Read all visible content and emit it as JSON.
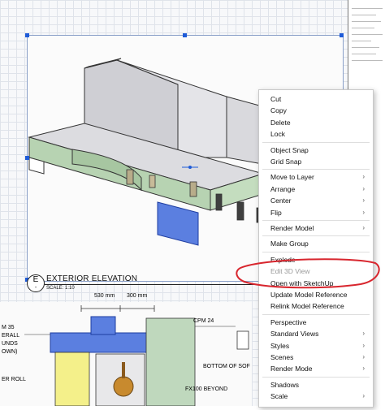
{
  "drawing": {
    "view_number": "E",
    "view_sub": "-",
    "view_title": "EXTERIOR ELEVATION",
    "scale": "SCALE: 1:10",
    "dim_left": "530 mm",
    "dim_right": "300 mm",
    "callouts": [
      "CPM 24",
      "BOTTOM OF SOF",
      "FX100 BEYOND"
    ],
    "left_notes": [
      "M 35",
      "ERALL",
      "UNDS",
      "OWN)",
      "ER ROLL"
    ]
  },
  "context_menu": {
    "groups": [
      [
        {
          "label": "Cut"
        },
        {
          "label": "Copy"
        },
        {
          "label": "Delete"
        },
        {
          "label": "Lock"
        }
      ],
      [
        {
          "label": "Object Snap"
        },
        {
          "label": "Grid Snap"
        }
      ],
      [
        {
          "label": "Move to Layer",
          "submenu": true
        },
        {
          "label": "Arrange",
          "submenu": true
        },
        {
          "label": "Center",
          "submenu": true
        },
        {
          "label": "Flip",
          "submenu": true
        }
      ],
      [
        {
          "label": "Render Model",
          "submenu": true
        }
      ],
      [
        {
          "label": "Make Group"
        }
      ],
      [
        {
          "label": "Explode"
        },
        {
          "label": "Edit 3D View",
          "disabled": true
        },
        {
          "label": "Open with SketchUp"
        },
        {
          "label": "Update Model Reference"
        },
        {
          "label": "Relink Model Reference"
        }
      ],
      [
        {
          "label": "Perspective"
        },
        {
          "label": "Standard Views",
          "submenu": true
        },
        {
          "label": "Styles",
          "submenu": true
        },
        {
          "label": "Scenes",
          "submenu": true
        },
        {
          "label": "Render Mode",
          "submenu": true
        }
      ],
      [
        {
          "label": "Shadows"
        },
        {
          "label": "Scale",
          "submenu": true
        }
      ]
    ],
    "submenu_arrow": "›"
  },
  "colors": {
    "annotation": "#d8262e",
    "selection": "#1e5bd8",
    "model_green": "#b7d3b2",
    "model_grey": "#d6d6da",
    "blue_panel": "#5b7fe0"
  }
}
